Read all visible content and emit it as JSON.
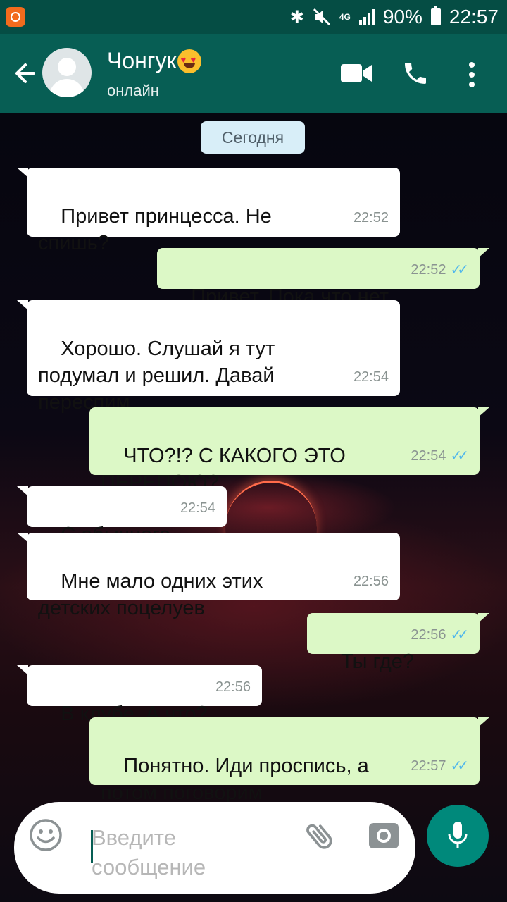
{
  "status_bar": {
    "signal_type": "4G",
    "battery": "90%",
    "time": "22:57"
  },
  "header": {
    "contact_name": "Чонгук",
    "contact_status": "онлайн",
    "emoji": "heart-eyes-emoji"
  },
  "chat": {
    "date_separator": "Сегодня",
    "messages": [
      {
        "direction": "in",
        "text": "Привет принцесса. Не\nспишь?",
        "time": "22:52"
      },
      {
        "direction": "out",
        "text": "Привет. Пока что нет.",
        "time": "22:52",
        "status": "read"
      },
      {
        "direction": "in",
        "text": "Хорошо. Слушай я тут\nподумал и решил. Давай\nпереспим.",
        "time": "22:54"
      },
      {
        "direction": "out",
        "text": "ЧТО?!? С КАКОГО ЭТО\nПЕРЕПОЮ?",
        "time": "22:54",
        "status": "read"
      },
      {
        "direction": "in",
        "text": "С обычного",
        "time": "22:54"
      },
      {
        "direction": "in",
        "text": "Мне мало одних этих\nдетских поцелуев",
        "time": "22:56"
      },
      {
        "direction": "out",
        "text": "Ты где?",
        "time": "22:56",
        "status": "read"
      },
      {
        "direction": "in",
        "text": "В клубе. А что?",
        "time": "22:56"
      },
      {
        "direction": "out",
        "text": "Понятно. Иди проспись, а\nпотом поговорим",
        "time": "22:57",
        "status": "read"
      }
    ]
  },
  "input": {
    "placeholder": "Введите\nсообщение"
  },
  "colors": {
    "header": "#075e54",
    "status_bar": "#054d44",
    "outgoing_bubble": "#dcf8c6",
    "incoming_bubble": "#ffffff",
    "read_ticks": "#4fb6ec",
    "mic_button": "#00897b"
  }
}
